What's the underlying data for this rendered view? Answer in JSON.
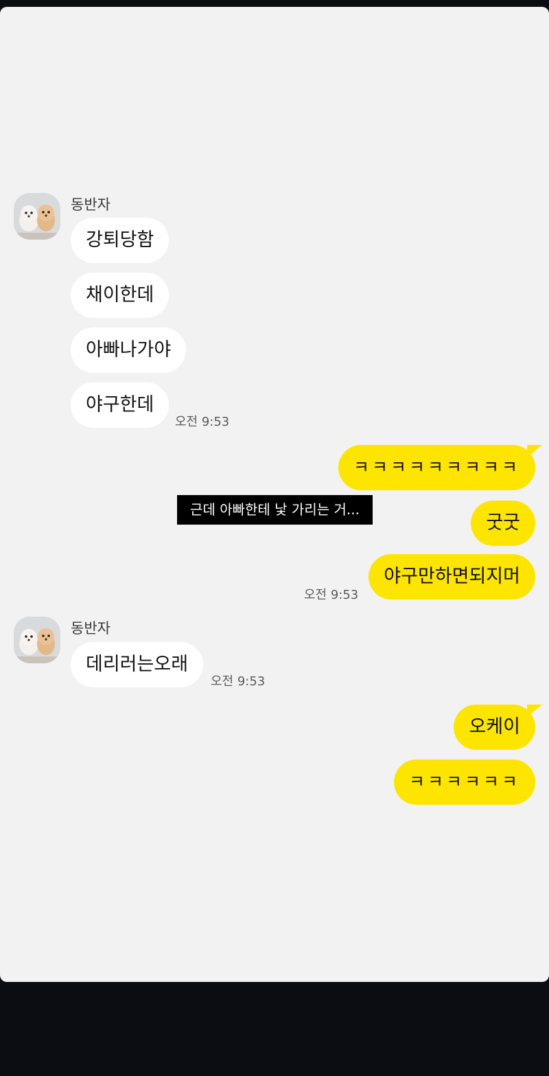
{
  "groups": [
    {
      "sender": "동반자",
      "messages": [
        "강퇴당함",
        "채이한데",
        "아빠나가야",
        "야구한데"
      ],
      "time": "오전 9:53"
    },
    {
      "sender": "동반자",
      "messages": [
        "데리러는오래"
      ],
      "time": "오전 9:53"
    }
  ],
  "outgoing": {
    "first": [
      "ㅋㅋㅋㅋㅋㅋㅋㅋㅋ",
      "굿굿",
      "야구만하면되지머"
    ],
    "first_time": "오전 9:53",
    "second": [
      "오케이",
      "ㅋㅋㅋㅋㅋㅋ"
    ]
  },
  "overlay_caption": "근데 아빠한테 낯 가리는 거...",
  "colors": {
    "outgoing_bubble": "#fde500",
    "incoming_bubble": "#ffffff",
    "chat_background": "#f2f2f2",
    "frame": "#0b0d12"
  }
}
